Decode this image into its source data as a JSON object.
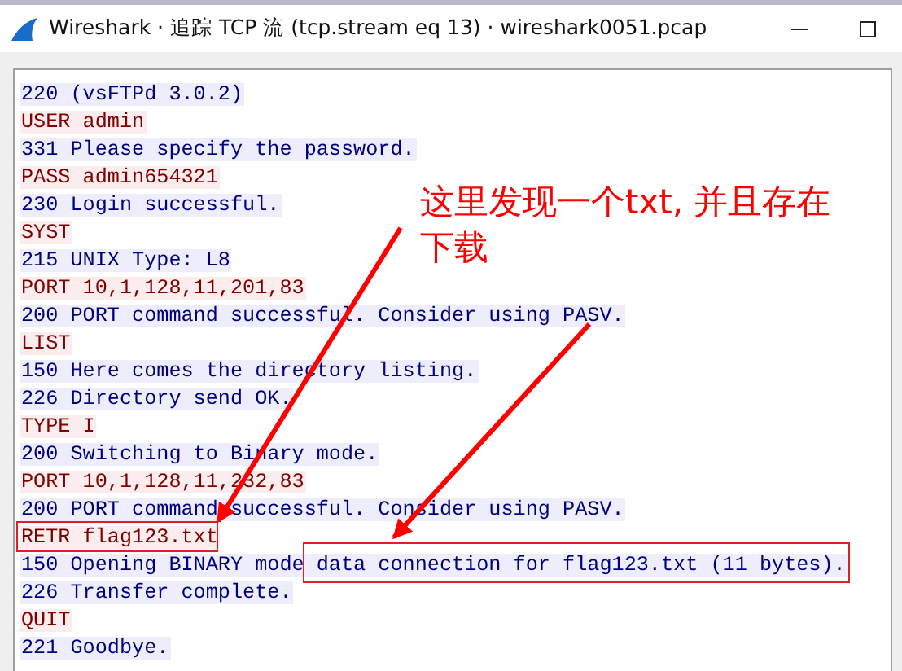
{
  "window": {
    "title": "Wireshark · 追踪 TCP 流 (tcp.stream eq 13) · wireshark0051.pcap"
  },
  "stream": [
    {
      "kind": "server",
      "text": "220 (vsFTPd 3.0.2)"
    },
    {
      "kind": "client",
      "text": "USER admin"
    },
    {
      "kind": "server",
      "text": "331 Please specify the password."
    },
    {
      "kind": "client",
      "text": "PASS admin654321"
    },
    {
      "kind": "server",
      "text": "230 Login successful."
    },
    {
      "kind": "client",
      "text": "SYST"
    },
    {
      "kind": "server",
      "text": "215 UNIX Type: L8"
    },
    {
      "kind": "client",
      "text": "PORT 10,1,128,11,201,83"
    },
    {
      "kind": "server",
      "text": "200 PORT command successful. Consider using PASV."
    },
    {
      "kind": "client",
      "text": "LIST"
    },
    {
      "kind": "server",
      "text": "150 Here comes the directory listing."
    },
    {
      "kind": "server",
      "text": "226 Directory send OK."
    },
    {
      "kind": "client",
      "text": "TYPE I"
    },
    {
      "kind": "server",
      "text": "200 Switching to Binary mode."
    },
    {
      "kind": "client",
      "text": "PORT 10,1,128,11,232,83"
    },
    {
      "kind": "server",
      "text": "200 PORT command successful. Consider using PASV."
    },
    {
      "kind": "client",
      "text": "RETR flag123.txt"
    },
    {
      "kind": "server",
      "text": "150 Opening BINARY mode data connection for flag123.txt (11 bytes)."
    },
    {
      "kind": "server",
      "text": "226 Transfer complete."
    },
    {
      "kind": "client",
      "text": "QUIT"
    },
    {
      "kind": "server",
      "text": "221 Goodbye."
    }
  ],
  "annotation": {
    "note": "这里发现一个txt, 并且存在下载"
  }
}
